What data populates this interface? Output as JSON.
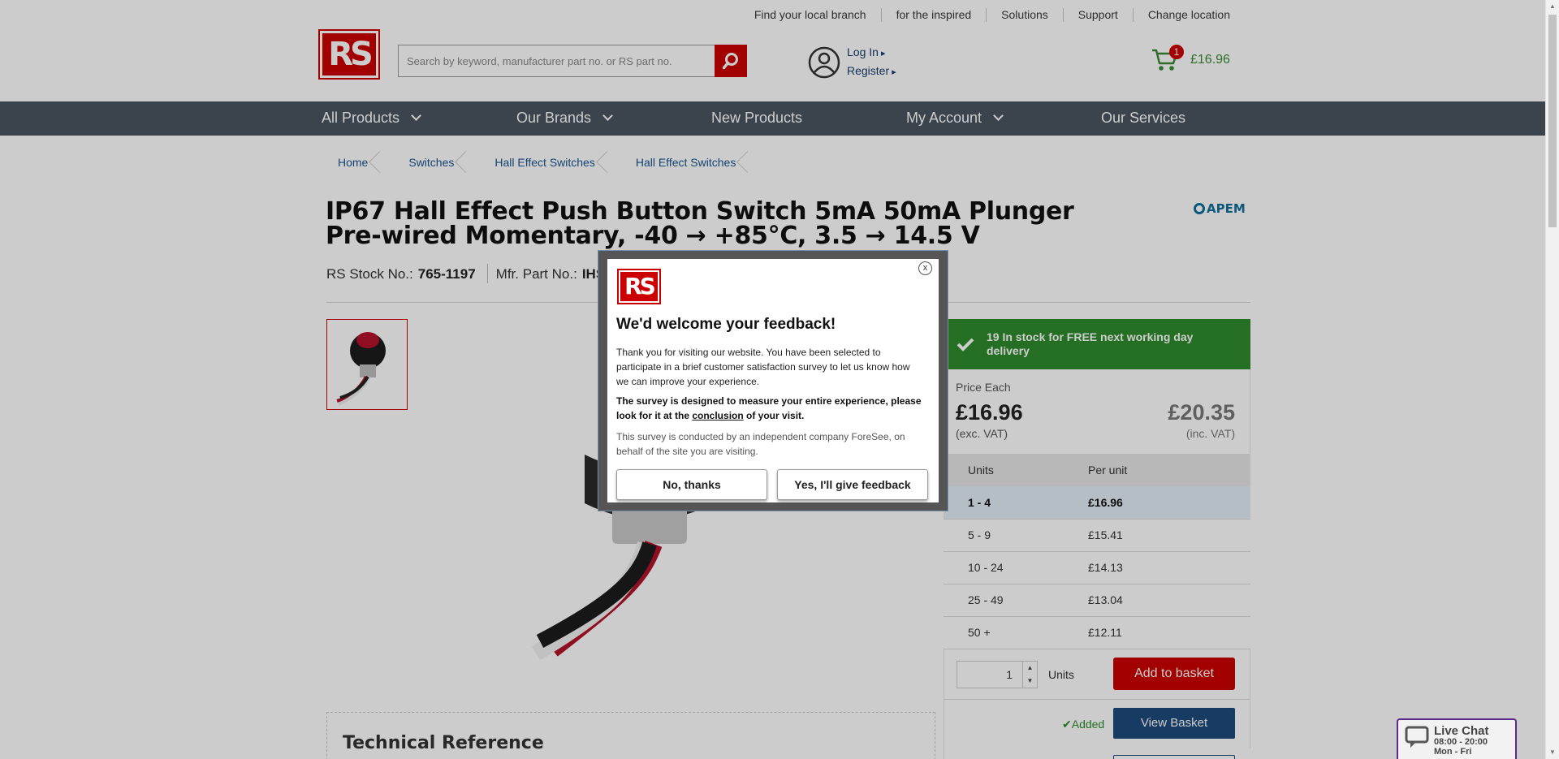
{
  "utility_nav": [
    "Find your local branch",
    "for the inspired",
    "Solutions",
    "Support",
    "Change location"
  ],
  "logo_text": "RS",
  "search": {
    "placeholder": "Search by keyword, manufacturer part no. or RS part no."
  },
  "account": {
    "login": "Log In",
    "register": "Register"
  },
  "basket": {
    "count": "1",
    "total": "£16.96"
  },
  "main_nav": [
    "All Products",
    "Our Brands",
    "New Products",
    "My Account",
    "Our Services"
  ],
  "breadcrumb": [
    "Home",
    "Switches",
    "Hall Effect Switches",
    "Hall Effect Switches"
  ],
  "product": {
    "title": "IP67 Hall Effect Push Button Switch 5mA 50mA Plunger Pre-wired Momentary, -40 → +85°C, 3.5 → 14.5 V",
    "brand": "APEM",
    "stock_no_label": "RS Stock No.:",
    "stock_no": "765-1197",
    "mfr_label": "Mfr. Part No.:",
    "mfr_no": "IHSH"
  },
  "stock_banner": "19 In stock for FREE next working day delivery",
  "pricing": {
    "label": "Price Each",
    "exc_price": "£16.96",
    "exc_label": "(exc. VAT)",
    "inc_price": "£20.35",
    "inc_label": "(inc. VAT)",
    "headers": [
      "Units",
      "Per unit"
    ],
    "tiers": [
      {
        "units": "1 - 4",
        "price": "£16.96"
      },
      {
        "units": "5 - 9",
        "price": "£15.41"
      },
      {
        "units": "10 - 24",
        "price": "£14.13"
      },
      {
        "units": "25 - 49",
        "price": "£13.04"
      },
      {
        "units": "50 +",
        "price": "£12.11"
      }
    ]
  },
  "quantity": {
    "value": "1",
    "units_label": "Units",
    "add_label": "Add to basket"
  },
  "added_label": "Added",
  "view_basket_label": "View Basket",
  "tech_ref": "Technical Reference",
  "live_chat": {
    "title": "Live Chat",
    "hours": "08:00 - 20:00",
    "days": "Mon - Fri"
  },
  "modal": {
    "close": "x",
    "title": "We'd welcome your feedback!",
    "p1": "Thank you for visiting our website. You have been selected to participate in a brief customer satisfaction survey to let us know how we can improve your experience.",
    "p2_before": "The survey is designed to measure your entire experience, please look for it at the ",
    "p2_link": "conclusion",
    "p2_after": " of your visit.",
    "p3": "This survey is conducted by an independent company ForeSee, on behalf of the site you are visiting.",
    "no_label": "No, thanks",
    "yes_label": "Yes, I'll give feedback"
  },
  "colors": {
    "brand_red": "#cc0000",
    "nav_bg": "#4a5561",
    "stock_green": "#2e8b2e",
    "link_blue": "#1a5490"
  }
}
